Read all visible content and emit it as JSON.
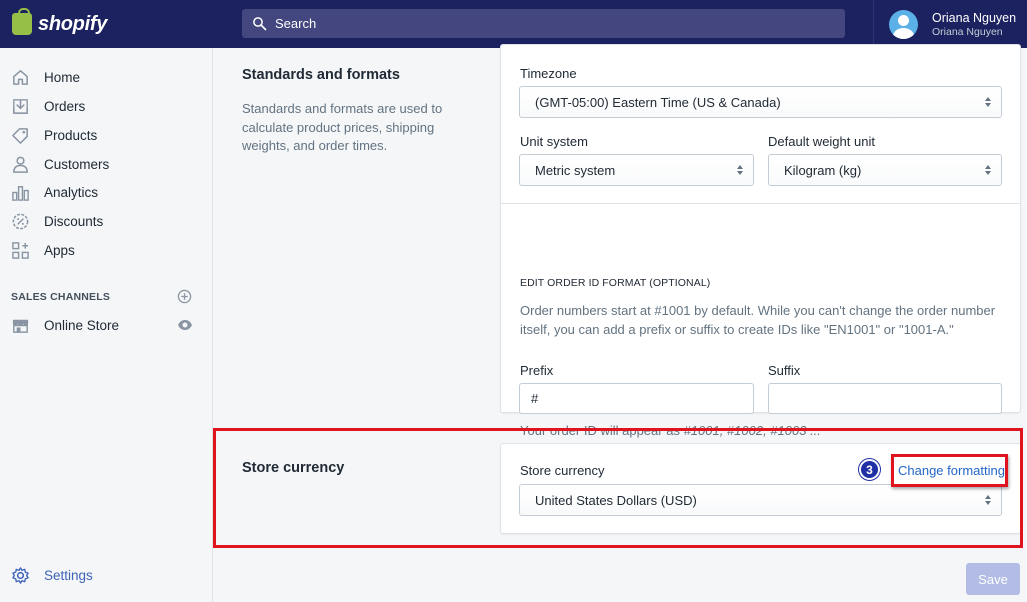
{
  "brand": {
    "name": "shopify",
    "accent": "#95bf47"
  },
  "search": {
    "placeholder": "Search"
  },
  "user": {
    "name": "Oriana Nguyen",
    "store": "Oriana Nguyen"
  },
  "sidebar": {
    "items": [
      {
        "label": "Home",
        "icon": "home-icon"
      },
      {
        "label": "Orders",
        "icon": "orders-icon"
      },
      {
        "label": "Products",
        "icon": "tag-icon"
      },
      {
        "label": "Customers",
        "icon": "person-icon"
      },
      {
        "label": "Analytics",
        "icon": "bar-chart-icon"
      },
      {
        "label": "Discounts",
        "icon": "discount-icon"
      },
      {
        "label": "Apps",
        "icon": "apps-icon"
      }
    ],
    "channels_heading": "SALES CHANNELS",
    "channels": [
      {
        "label": "Online Store",
        "icon": "store-icon"
      }
    ],
    "settings_label": "Settings"
  },
  "standards": {
    "title": "Standards and formats",
    "description": "Standards and formats are used to calculate product prices, shipping weights, and order times.",
    "timezone_label": "Timezone",
    "timezone_value": "(GMT-05:00) Eastern Time (US & Canada)",
    "unit_system_label": "Unit system",
    "unit_system_value": "Metric system",
    "weight_unit_label": "Default weight unit",
    "weight_unit_value": "Kilogram (kg)",
    "order_id_heading": "EDIT ORDER ID FORMAT (OPTIONAL)",
    "order_id_help": "Order numbers start at #1001 by default. While you can't change the order number itself, you can add a prefix or suffix to create IDs like \"EN1001\" or \"1001-A.\"",
    "prefix_label": "Prefix",
    "prefix_value": "#",
    "suffix_label": "Suffix",
    "suffix_value": "",
    "preview_text": "Your order ID will appear as",
    "preview_example": "#1001, #1002, #1003 ..."
  },
  "currency": {
    "title": "Store currency",
    "label": "Store currency",
    "value": "United States Dollars (USD)",
    "change_link": "Change formatting",
    "step_badge": "3"
  },
  "footer": {
    "save_label": "Save"
  }
}
